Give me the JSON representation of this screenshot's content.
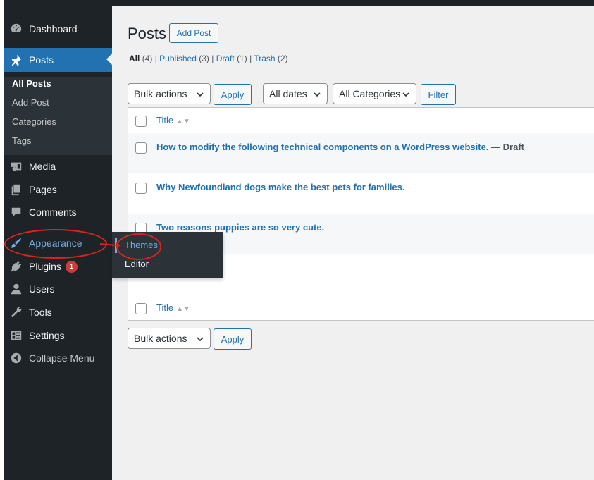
{
  "sidebar": {
    "dashboard": "Dashboard",
    "posts": "Posts",
    "posts_submenu": [
      "All Posts",
      "Add Post",
      "Categories",
      "Tags"
    ],
    "media": "Media",
    "pages": "Pages",
    "comments": "Comments",
    "appearance": "Appearance",
    "plugins": "Plugins",
    "plugins_badge": "1",
    "users": "Users",
    "tools": "Tools",
    "settings": "Settings",
    "collapse": "Collapse Menu"
  },
  "flyout": {
    "items": [
      "Themes",
      "Editor"
    ]
  },
  "main": {
    "title": "Posts",
    "add_post_button": "Add Post",
    "filters": {
      "all_label": "All",
      "all_count": "(4)",
      "published_label": "Published",
      "published_count": "(3)",
      "draft_label": "Draft",
      "draft_count": "(1)",
      "trash_label": "Trash",
      "trash_count": "(2)",
      "separator": "|"
    },
    "bulk_actions": "Bulk actions",
    "apply": "Apply",
    "all_dates": "All dates",
    "all_categories": "All Categories",
    "filter": "Filter",
    "column_title": "Title",
    "rows": [
      {
        "title": "How to modify the following technical components on a WordPress website.",
        "state": " — Draft"
      },
      {
        "title": "Why Newfoundland dogs make the best pets for families.",
        "state": ""
      },
      {
        "title": "Two reasons puppies are so very cute.",
        "state": ""
      },
      {
        "title": "",
        "state": ""
      }
    ]
  },
  "colors": {
    "sidebar_bg": "#1d2327",
    "accent": "#2271b1",
    "highlight": "#72aee6",
    "annotation": "#d9261c",
    "badge": "#d63638"
  }
}
